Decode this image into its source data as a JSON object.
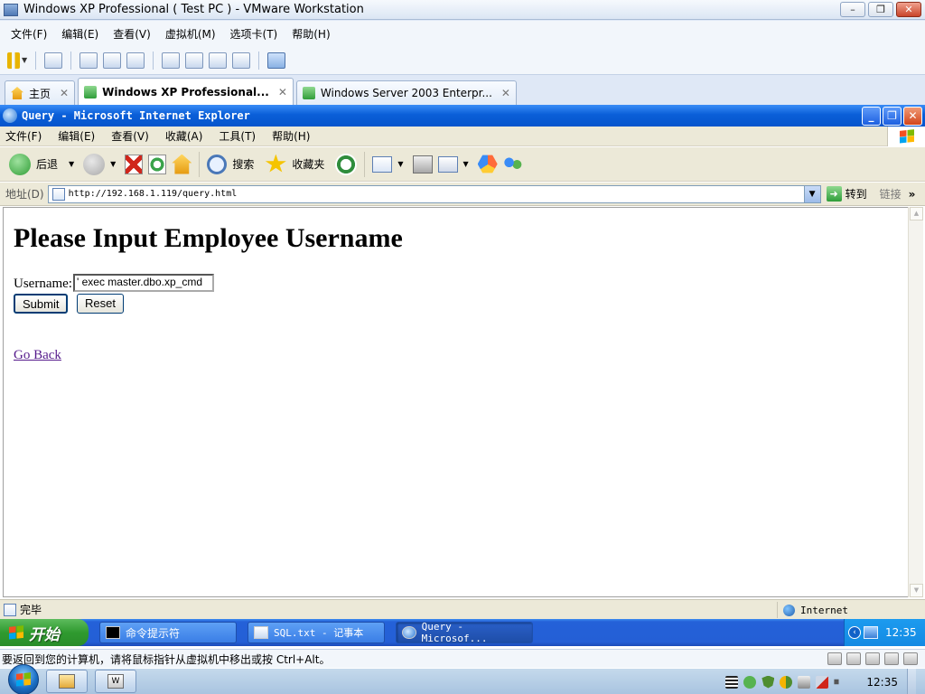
{
  "vmware": {
    "title": "Windows XP Professional ( Test PC ) - VMware Workstation",
    "window_controls": {
      "minimize": "–",
      "restore": "❐",
      "close": "✕"
    },
    "menu": [
      "文件(F)",
      "编辑(E)",
      "查看(V)",
      "虚拟机(M)",
      "选项卡(T)",
      "帮助(H)"
    ],
    "tabs": [
      {
        "label": "主页",
        "close": "✕"
      },
      {
        "label": "Windows XP Professional...",
        "close": "✕"
      },
      {
        "label": "Windows Server 2003 Enterpr...",
        "close": "✕"
      }
    ],
    "status_message": "要返回到您的计算机，请将鼠标指针从虚拟机中移出或按 Ctrl+Alt。"
  },
  "ie": {
    "title": "Query - Microsoft Internet Explorer",
    "window_controls": {
      "minimize": "_",
      "restore": "❐",
      "close": "✕"
    },
    "menu": [
      "文件(F)",
      "编辑(E)",
      "查看(V)",
      "收藏(A)",
      "工具(T)",
      "帮助(H)"
    ],
    "toolbar": {
      "back_label": "后退",
      "search_label": "搜索",
      "favorites_label": "收藏夹"
    },
    "address": {
      "label": "地址(D)",
      "url": "http://192.168.1.119/query.html",
      "go_label": "转到",
      "links_label": "链接",
      "links_chevron": "»"
    },
    "status": {
      "text": "完毕",
      "zone": "Internet"
    }
  },
  "page": {
    "heading": "Please Input Employee Username",
    "username_label": "Username:",
    "username_value": "' exec master.dbo.xp_cmd",
    "submit_label": "Submit",
    "reset_label": "Reset",
    "go_back_label": "Go Back"
  },
  "xp_taskbar": {
    "start_label": "开始",
    "items": [
      {
        "label": "命令提示符",
        "icon": "cmd-icon"
      },
      {
        "label": "SQL.txt - 记事本",
        "icon": "notepad-icon"
      },
      {
        "label": "Query - Microsof...",
        "icon": "ie-icon"
      }
    ],
    "tray_chevron": "‹",
    "clock": "12:35"
  },
  "host_taskbar": {
    "pinned": [
      {
        "icon": "explorer-icon"
      },
      {
        "icon": "vmware-icon",
        "glyph": "W"
      }
    ],
    "clock": "12:35"
  }
}
